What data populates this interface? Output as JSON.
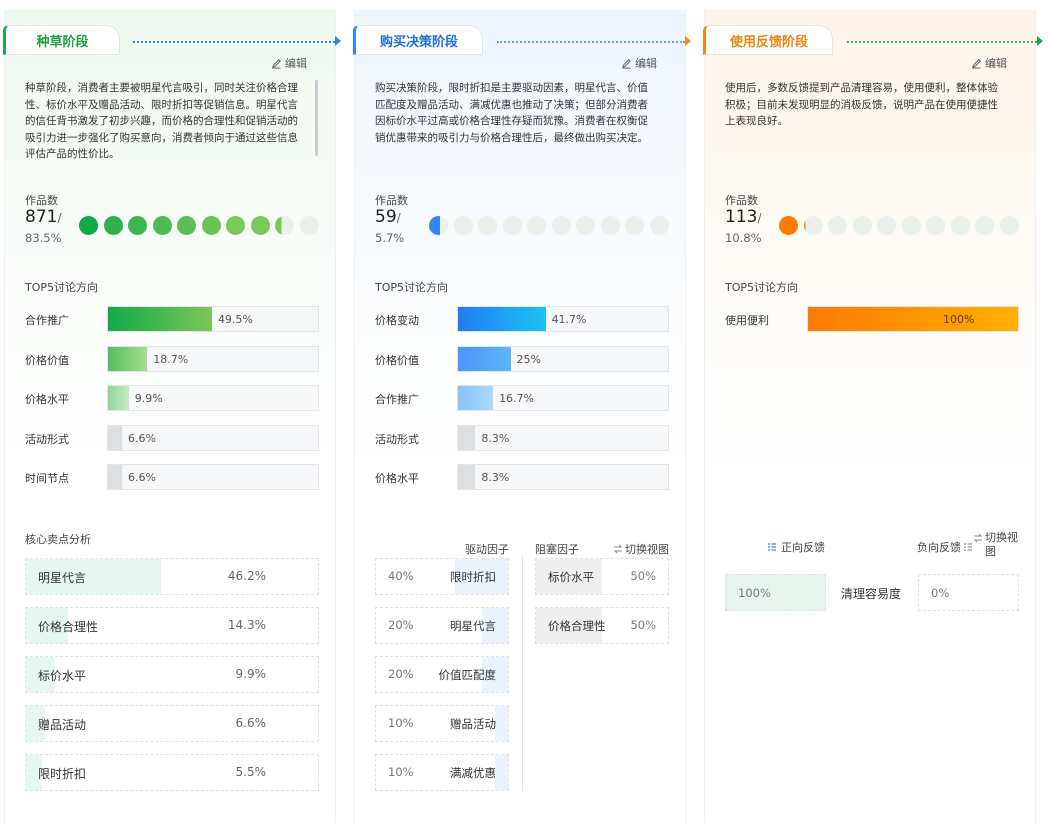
{
  "edit_label": "编辑",
  "count_label": "作品数",
  "top5_label": "TOP5讨论方向",
  "colors": {
    "green": "#22a84a",
    "blue": "#2f86f6",
    "orange": "#f08a16"
  },
  "stages": [
    {
      "title": "种草阶段",
      "description": "种草阶段，消费者主要被明星代言吸引，同时关注价格合理性、标价水平及赠品活动、限时折扣等促销信息。明星代言的信任背书激发了初步兴趣，而价格的合理性和促销活动的吸引力进一步强化了购买意向，消费者倾向于通过这些信息评估产品的性价比。",
      "count": "871",
      "count_suffix": "/",
      "count_pct": "83.5%",
      "count_fraction": 0.835,
      "top5": [
        {
          "label": "合作推广",
          "value": "49.5%",
          "ratio": 0.495
        },
        {
          "label": "价格价值",
          "value": "18.7%",
          "ratio": 0.187
        },
        {
          "label": "价格水平",
          "value": "9.9%",
          "ratio": 0.099
        },
        {
          "label": "活动形式",
          "value": "6.6%",
          "ratio": 0.066
        },
        {
          "label": "时间节点",
          "value": "6.6%",
          "ratio": 0.066
        }
      ],
      "section_title": "核心卖点分析",
      "selling_points": [
        {
          "label": "明星代言",
          "value": "46.2%",
          "ratio": 0.462
        },
        {
          "label": "价格合理性",
          "value": "14.3%",
          "ratio": 0.143
        },
        {
          "label": "标价水平",
          "value": "9.9%",
          "ratio": 0.099
        },
        {
          "label": "赠品活动",
          "value": "6.6%",
          "ratio": 0.066
        },
        {
          "label": "限时折扣",
          "value": "5.5%",
          "ratio": 0.055
        }
      ]
    },
    {
      "title": "购买决策阶段",
      "description": "购买决策阶段，限时折扣是主要驱动因素，明星代言、价值匹配度及赠品活动、满减优惠也推动了决策；但部分消费者因标价水平过高或价格合理性存疑而犹豫。消费者在权衡促销优惠带来的吸引力与价格合理性后，最终做出购买决定。",
      "count": "59",
      "count_suffix": "/",
      "count_pct": "5.7%",
      "count_fraction": 0.057,
      "top5": [
        {
          "label": "价格变动",
          "value": "41.7%",
          "ratio": 0.417
        },
        {
          "label": "价格价值",
          "value": "25%",
          "ratio": 0.25
        },
        {
          "label": "合作推广",
          "value": "16.7%",
          "ratio": 0.167
        },
        {
          "label": "活动形式",
          "value": "8.3%",
          "ratio": 0.083
        },
        {
          "label": "价格水平",
          "value": "8.3%",
          "ratio": 0.083
        }
      ],
      "drivers_label": "驱动因子",
      "blockers_label": "阻塞因子",
      "switch_label": "切换视图",
      "drivers": [
        {
          "pct": "40%",
          "label": "限时折扣",
          "ratio": 0.4
        },
        {
          "pct": "20%",
          "label": "明星代言",
          "ratio": 0.2
        },
        {
          "pct": "20%",
          "label": "价值匹配度",
          "ratio": 0.2
        },
        {
          "pct": "10%",
          "label": "赠品活动",
          "ratio": 0.1
        },
        {
          "pct": "10%",
          "label": "满减优惠",
          "ratio": 0.1
        }
      ],
      "blockers": [
        {
          "label": "标价水平",
          "pct": "50%",
          "ratio": 0.5
        },
        {
          "label": "价格合理性",
          "pct": "50%",
          "ratio": 0.5
        }
      ]
    },
    {
      "title": "使用反馈阶段",
      "description": "使用后，多数反馈提到产品清理容易，使用便利，整体体验积极；目前未发现明显的消极反馈，说明产品在使用便捷性上表现良好。",
      "count": "113",
      "count_suffix": "/",
      "count_pct": "10.8%",
      "count_fraction": 0.108,
      "top5": [
        {
          "label": "使用便利",
          "value": "100%",
          "ratio": 1.0
        }
      ],
      "positive_label": "正向反馈",
      "negative_label": "负向反馈",
      "switch_label": "切换视图",
      "feedback": {
        "positive": "100%",
        "aspect": "清理容易度",
        "negative": "0%"
      }
    }
  ]
}
